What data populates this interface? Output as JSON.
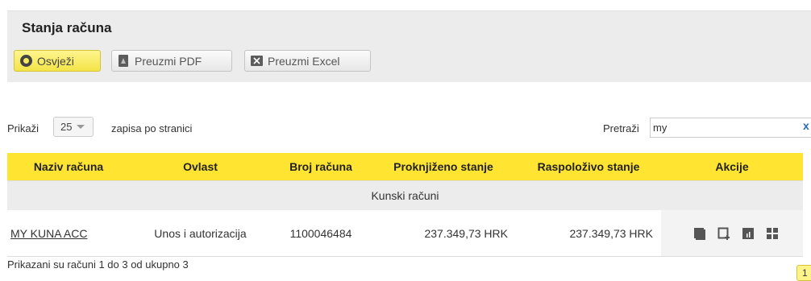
{
  "panel": {
    "title": "Stanja računa",
    "buttons": {
      "refresh": "Osvježi",
      "pdf": "Preuzmi PDF",
      "excel": "Preuzmi Excel"
    }
  },
  "length": {
    "prefix": "Prikaži",
    "value": "25",
    "suffix": "zapisa po stranici"
  },
  "search": {
    "label": "Pretraži",
    "value": "my",
    "clear": "x"
  },
  "table": {
    "headers": [
      "Naziv računa",
      "Ovlast",
      "Broj računa",
      "Proknjiženo stanje",
      "Raspoloživo stanje",
      "Akcije"
    ],
    "group": "Kunski računi",
    "rows": [
      {
        "name": "MY KUNA ACC",
        "authority": "Unos i autorizacija",
        "number": "1100046484",
        "booked": "237.349,73 HRK",
        "available": "237.349,73 HRK"
      }
    ],
    "action_icons": [
      "details-icon",
      "new-payment-icon",
      "chart-icon",
      "grid-icon"
    ]
  },
  "info": "Prikazani su računi 1 do 3 od ukupno 3",
  "pager": {
    "current": "1"
  },
  "colors": {
    "header_yellow": "#ffe432",
    "refresh_yellow": "#f7ea5c",
    "panel_gray": "#ececec",
    "icon_gray": "#555555"
  }
}
